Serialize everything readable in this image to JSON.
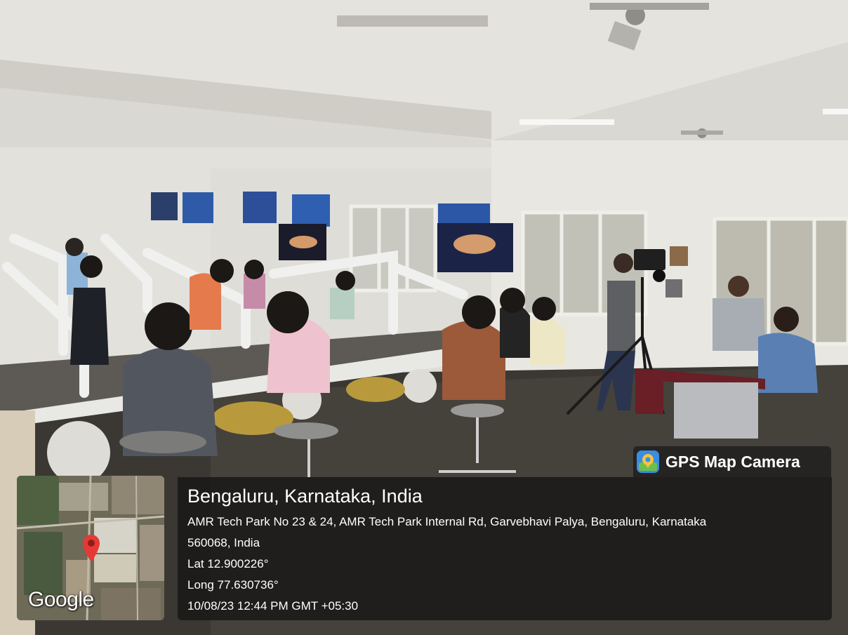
{
  "photo": {
    "scene_icons": [
      "ceiling-fan-icon",
      "tv-screen-icon",
      "video-camera-icon",
      "tripod-icon"
    ]
  },
  "watermark": {
    "app_name": "GPS Map Camera",
    "icon": "gps-pin-icon"
  },
  "map": {
    "brand": "Google",
    "pin_icon": "map-pin-icon",
    "pin_color": "#e53935"
  },
  "location": {
    "place": "Bengaluru, Karnataka, India",
    "address_line1": "AMR Tech Park No 23 & 24, AMR Tech Park Internal Rd, Garvebhavi Palya, Bengaluru, Karnataka",
    "address_line2": "560068, India",
    "lat": "Lat 12.900226°",
    "long": "Long 77.630736°",
    "timestamp": "10/08/23 12:44 PM GMT +05:30"
  }
}
